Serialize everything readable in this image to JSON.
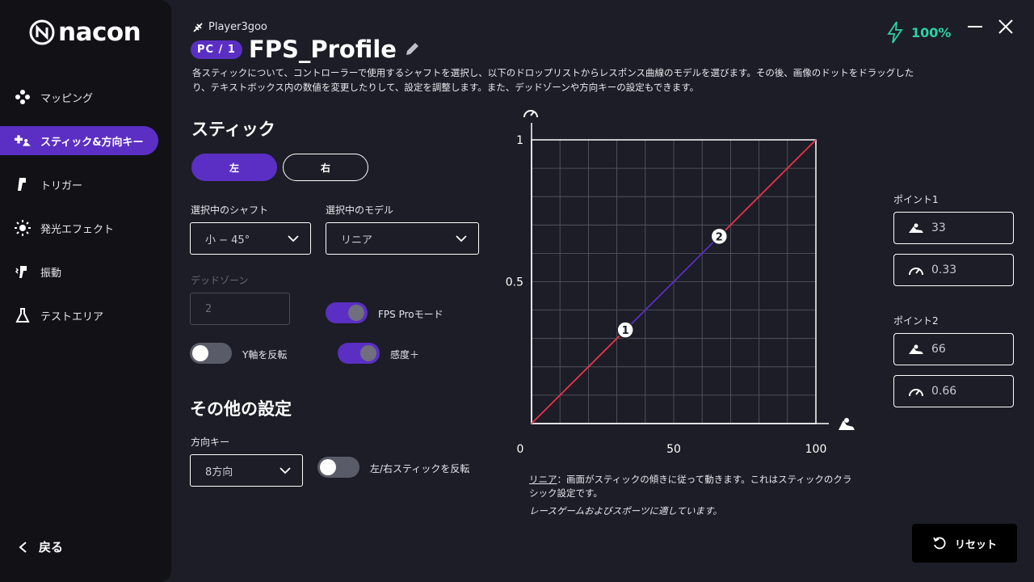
{
  "brand": {
    "logo_text": "nacon"
  },
  "sidebar": {
    "items": [
      {
        "label": "マッピング",
        "icon": "gamepad-buttons-icon",
        "active": false
      },
      {
        "label": "スティック&方向キー",
        "icon": "stick-dpad-icon",
        "active": true
      },
      {
        "label": "トリガー",
        "icon": "trigger-icon",
        "active": false
      },
      {
        "label": "発光エフェクト",
        "icon": "light-effect-icon",
        "active": false
      },
      {
        "label": "振動",
        "icon": "vibration-icon",
        "active": false
      },
      {
        "label": "テストエリア",
        "icon": "flask-icon",
        "active": false
      }
    ],
    "back_label": "戻る"
  },
  "header": {
    "player_name": "Player3goo",
    "platform_badge": "PC / 1",
    "profile_title": "FPS_Profile",
    "description": "各スティックについて、コントローラーで使用するシャフトを選択し、以下のドロップリストからレスポンス曲線のモデルを選びます。その後、画像のドットをドラッグしたり、テキストボックス内の数値を変更したりして、設定を調整します。また、デッドゾーンや方向キーの設定もできます。",
    "battery": "100%"
  },
  "stick": {
    "section_title": "スティック",
    "left_label": "左",
    "right_label": "右",
    "shaft_label": "選択中のシャフト",
    "shaft_value": "小 − 45°",
    "model_label": "選択中のモデル",
    "model_value": "リニア",
    "deadzone_label": "デッドゾーン",
    "deadzone_value": "2",
    "fps_pro_label": "FPS Proモード",
    "fps_pro_on": true,
    "invert_y_label": "Y軸を反転",
    "invert_y_on": false,
    "sensitivity_label": "感度＋",
    "sensitivity_on": true
  },
  "other": {
    "section_title": "その他の設定",
    "dpad_label": "方向キー",
    "dpad_value": "8方向",
    "swap_label": "左/右スティックを反転",
    "swap_on": false
  },
  "chart_data": {
    "type": "line",
    "x_ticks": [
      "0",
      "50",
      "100"
    ],
    "y_ticks": [
      "1",
      "0.5"
    ],
    "xlim": [
      0,
      100
    ],
    "ylim": [
      0,
      1
    ],
    "grid": true,
    "series": [
      {
        "x": [
          0,
          100
        ],
        "y": [
          0,
          1
        ]
      }
    ],
    "points": [
      {
        "label": "1",
        "x": 33,
        "y": 0.33
      },
      {
        "label": "2",
        "x": 66,
        "y": 0.66
      }
    ],
    "colors": {
      "outer": "#e8334a",
      "middle": "#5b2fc4"
    }
  },
  "chart_note": {
    "model_name": "リニア",
    "text": "：画面がスティックの傾きに従って動きます。これはスティックのクラシック設定です。",
    "subtext": "レースゲームおよびスポーツに適しています。"
  },
  "points_panel": {
    "point1_label": "ポイント1",
    "point1_x": "33",
    "point1_y": "0.33",
    "point2_label": "ポイント2",
    "point2_x": "66",
    "point2_y": "0.66"
  },
  "reset_label": "リセット"
}
